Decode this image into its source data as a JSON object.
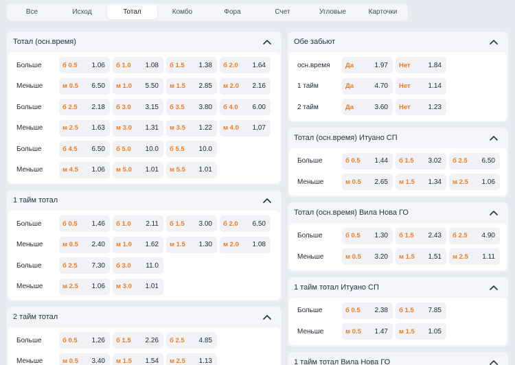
{
  "tabs": [
    "Все",
    "Исход",
    "Тотал",
    "Комбо",
    "Фора",
    "Счет",
    "Угловые",
    "Карточки"
  ],
  "active_tab": 2,
  "left_cards": [
    {
      "title": "Тотал (осн.время)",
      "rows": [
        {
          "label": "Больше",
          "odds": [
            [
              "б 0.5",
              "1.06"
            ],
            [
              "б 1.0",
              "1.08"
            ],
            [
              "б 1.5",
              "1.38"
            ],
            [
              "б 2.0",
              "1.64"
            ]
          ]
        },
        {
          "label": "Меньше",
          "odds": [
            [
              "м 0.5",
              "6.50"
            ],
            [
              "м 1.0",
              "5.50"
            ],
            [
              "м 1.5",
              "2.85"
            ],
            [
              "м 2.0",
              "2.16"
            ]
          ]
        },
        {
          "label": "Больше",
          "odds": [
            [
              "б 2.5",
              "2.18"
            ],
            [
              "б 3.0",
              "3.15"
            ],
            [
              "б 3.5",
              "3.80"
            ],
            [
              "б 4.0",
              "6.00"
            ]
          ]
        },
        {
          "label": "Меньше",
          "odds": [
            [
              "м 2.5",
              "1.63"
            ],
            [
              "м 3.0",
              "1.31"
            ],
            [
              "м 3.5",
              "1.22"
            ],
            [
              "м 4.0",
              "1.07"
            ]
          ]
        },
        {
          "label": "Больше",
          "odds": [
            [
              "б 4.5",
              "6.50"
            ],
            [
              "б 5.0",
              "10.0"
            ],
            [
              "б 5.5",
              "10.0"
            ]
          ]
        },
        {
          "label": "Меньше",
          "odds": [
            [
              "м 4.5",
              "1.06"
            ],
            [
              "м 5.0",
              "1.01"
            ],
            [
              "м 5.5",
              "1.01"
            ]
          ]
        }
      ]
    },
    {
      "title": "1 тайм тотал",
      "rows": [
        {
          "label": "Больше",
          "odds": [
            [
              "б 0.5",
              "1.46"
            ],
            [
              "б 1.0",
              "2.11"
            ],
            [
              "б 1.5",
              "3.00"
            ],
            [
              "б 2.0",
              "6.50"
            ]
          ]
        },
        {
          "label": "Меньше",
          "odds": [
            [
              "м 0.5",
              "2.40"
            ],
            [
              "м 1.0",
              "1.62"
            ],
            [
              "м 1.5",
              "1.30"
            ],
            [
              "м 2.0",
              "1.08"
            ]
          ]
        },
        {
          "label": "Больше",
          "odds": [
            [
              "б 2.5",
              "7.30"
            ],
            [
              "б 3.0",
              "11.0"
            ]
          ]
        },
        {
          "label": "Меньше",
          "odds": [
            [
              "м 2.5",
              "1.06"
            ],
            [
              "м 3.0",
              "1.01"
            ]
          ]
        }
      ]
    },
    {
      "title": "2 тайм тотал",
      "rows": [
        {
          "label": "Больше",
          "odds": [
            [
              "б 0.5",
              "1.26"
            ],
            [
              "б 1.5",
              "2.26"
            ],
            [
              "б 2.5",
              "4.85"
            ]
          ]
        },
        {
          "label": "Меньше",
          "odds": [
            [
              "м 0.5",
              "3.40"
            ],
            [
              "м 1.5",
              "1.54"
            ],
            [
              "м 2.5",
              "1.13"
            ]
          ]
        }
      ]
    }
  ],
  "right_cards": [
    {
      "title": "Обе забьют",
      "rows": [
        {
          "label": "осн.время",
          "odds": [
            [
              "Да",
              "1.97"
            ],
            [
              "Нет",
              "1.84"
            ]
          ]
        },
        {
          "label": "1 тайм",
          "odds": [
            [
              "Да",
              "4.70"
            ],
            [
              "Нет",
              "1.14"
            ]
          ]
        },
        {
          "label": "2 тайм",
          "odds": [
            [
              "Да",
              "3.60"
            ],
            [
              "Нет",
              "1.23"
            ]
          ]
        }
      ]
    },
    {
      "title": "Тотал (осн.время) Итуано СП",
      "rows": [
        {
          "label": "Больше",
          "odds": [
            [
              "б 0.5",
              "1.44"
            ],
            [
              "б 1.5",
              "3.02"
            ],
            [
              "б 2.5",
              "6.50"
            ]
          ]
        },
        {
          "label": "Меньше",
          "odds": [
            [
              "м 0.5",
              "2.65"
            ],
            [
              "м 1.5",
              "1.34"
            ],
            [
              "м 2.5",
              "1.06"
            ]
          ]
        }
      ]
    },
    {
      "title": "Тотал (осн.время) Вила Нова ГО",
      "rows": [
        {
          "label": "Больше",
          "odds": [
            [
              "б 0.5",
              "1.30"
            ],
            [
              "б 1.5",
              "2.43"
            ],
            [
              "б 2.5",
              "4.90"
            ]
          ]
        },
        {
          "label": "Меньше",
          "odds": [
            [
              "м 0.5",
              "3.20"
            ],
            [
              "м 1.5",
              "1.51"
            ],
            [
              "м 2.5",
              "1.11"
            ]
          ]
        }
      ]
    },
    {
      "title": "1 тайм тотал Итуано СП",
      "rows": [
        {
          "label": "Больше",
          "odds": [
            [
              "б 0.5",
              "2.38"
            ],
            [
              "б 1.5",
              "7.85"
            ]
          ]
        },
        {
          "label": "Меньше",
          "odds": [
            [
              "м 0.5",
              "1.47"
            ],
            [
              "м 1.5",
              "1.05"
            ]
          ]
        }
      ]
    },
    {
      "title": "1 тайм тотал Вила Нова ГО",
      "rows": []
    }
  ],
  "colors": {
    "accent": "#f07b1e",
    "background": "#e7eaf0",
    "card": "#f3f5f8"
  },
  "icons": {
    "collapse": "chevron-up-icon"
  }
}
